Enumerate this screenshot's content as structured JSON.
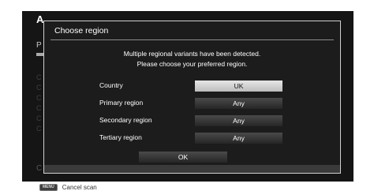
{
  "background": {
    "title": "A",
    "subtitle": "P",
    "progress": 0.04,
    "list_items": [
      "C",
      "C",
      "C",
      "C",
      "C",
      "C"
    ],
    "bottom_char": "C"
  },
  "dialog": {
    "title": "Choose region",
    "message_line1": "Multiple regional variants have been detected.",
    "message_line2": "Please choose your preferred region.",
    "rows": [
      {
        "label": "Country",
        "value": "UK",
        "selected": true
      },
      {
        "label": "Primary region",
        "value": "Any",
        "selected": false
      },
      {
        "label": "Secondary region",
        "value": "Any",
        "selected": false
      },
      {
        "label": "Tertiary region",
        "value": "Any",
        "selected": false
      }
    ],
    "ok_label": "OK"
  },
  "footer": {
    "key_label": "MENU",
    "action_label": "Cancel scan"
  },
  "colors": {
    "dialog_bg": "#1c1c1c",
    "selected_button": "#d9d9d9",
    "button": "#3a3a3a"
  }
}
